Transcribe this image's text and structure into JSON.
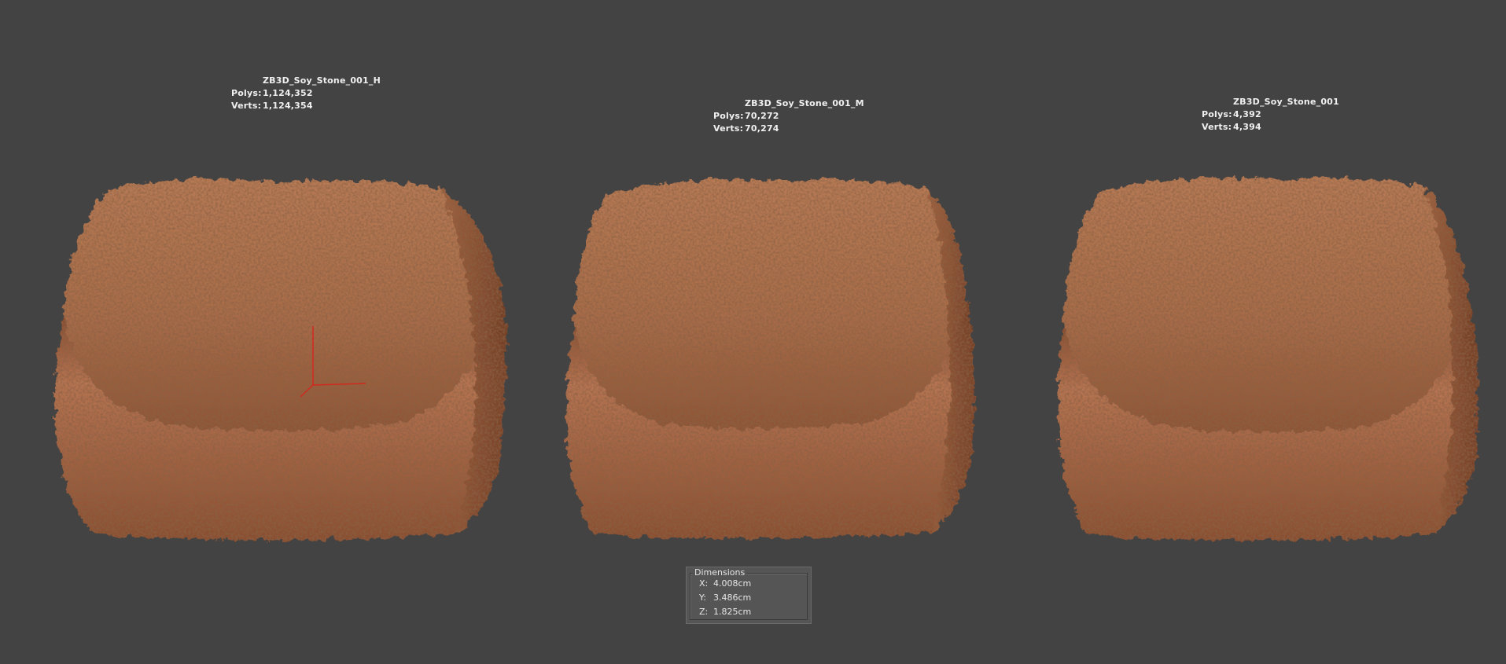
{
  "viewport": {
    "background": "#434343"
  },
  "models": [
    {
      "name": "ZB3D_Soy_Stone_001_H",
      "polys_label": "Polys:",
      "polys": "1,124,352",
      "verts_label": "Verts:",
      "verts": "1,124,354"
    },
    {
      "name": "ZB3D_Soy_Stone_001_M",
      "polys_label": "Polys:",
      "polys": "70,272",
      "verts_label": "Verts:",
      "verts": "70,274"
    },
    {
      "name": "ZB3D_Soy_Stone_001",
      "polys_label": "Polys:",
      "polys": "4,392",
      "verts_label": "Verts:",
      "verts": "4,394"
    }
  ],
  "dimensions": {
    "title": "Dimensions",
    "x_label": "X:",
    "x": "4.008cm",
    "y_label": "Y:",
    "y": "3.486cm",
    "z_label": "Z:",
    "z": "1.825cm"
  },
  "colors": {
    "stone_light": "#c98a62",
    "stone_mid": "#9a5a38",
    "stone_dark": "#5a2f1c",
    "gizmo": "#d02a1e"
  }
}
